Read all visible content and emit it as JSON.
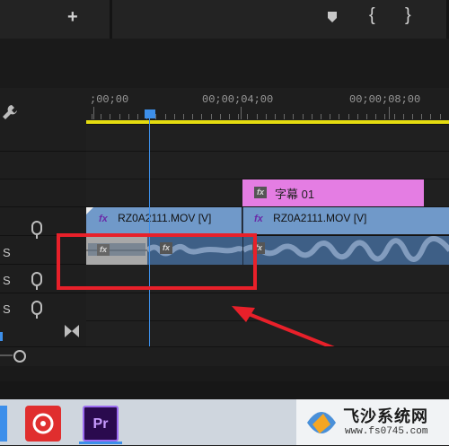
{
  "toolbar": {
    "add_label": "+",
    "marker_icon": "marker-icon",
    "in_label": "{",
    "out_label": "}"
  },
  "ruler": {
    "tc_start": ";00;00",
    "tc_mid": "00;00;04;00",
    "tc_end": "00;00;08;00"
  },
  "tracks": {
    "s_label": "S"
  },
  "clips": {
    "caption": {
      "fx": "fx",
      "label": "字幕 01",
      "color": "#e47de3"
    },
    "video1": {
      "fx": "fx",
      "label": "RZ0A2111.MOV [V]",
      "color": "#7099c9"
    },
    "video2": {
      "fx": "fx",
      "label": "RZ0A2111.MOV [V]",
      "color": "#7099c9"
    },
    "audio1_fx": "fx",
    "audio2_fx": "fx",
    "audio3_fx": "fx"
  },
  "colors": {
    "playhead": "#3d8fea",
    "workarea": "#e5dc10",
    "highlight": "#e8202a"
  },
  "taskbar": {
    "pr_label": "Pr"
  },
  "watermark": {
    "title": "飞沙系统网",
    "url": "www.fs0745.com"
  }
}
